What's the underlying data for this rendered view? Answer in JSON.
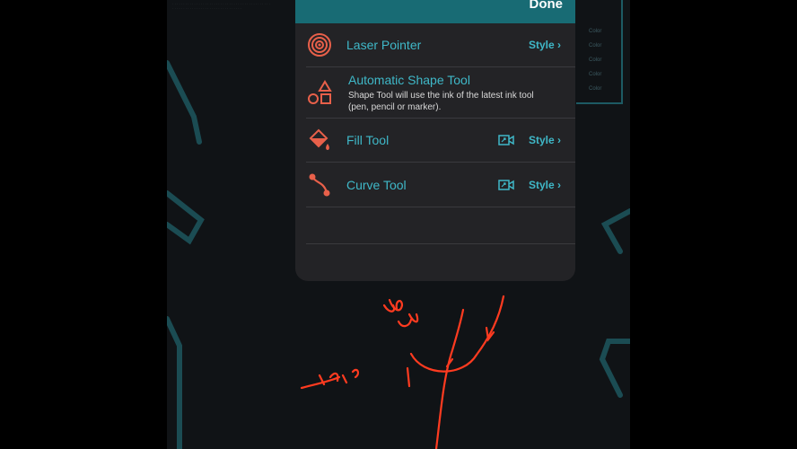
{
  "popover": {
    "done_label": "Done",
    "tools": [
      {
        "label": "Laser Pointer",
        "style_label": "Style ›",
        "icon": "laser-pointer-icon"
      },
      {
        "label": "Automatic Shape Tool",
        "description": "Shape Tool will use the ink of the latest ink tool (pen, pencil or marker).",
        "icon": "shapes-icon"
      },
      {
        "label": "Fill Tool",
        "style_label": "Style ›",
        "icon": "fill-bucket-icon"
      },
      {
        "label": "Curve Tool",
        "style_label": "Style ›",
        "icon": "curve-icon"
      }
    ]
  },
  "background": {
    "color_labels": [
      "Color",
      "Color",
      "Color",
      "Color",
      "Color"
    ],
    "handwriting": "~Betty"
  },
  "colors": {
    "accent": "#3fb8c8",
    "header": "#186b74",
    "icon": "#e8604a",
    "ink": "#ff3b20"
  }
}
